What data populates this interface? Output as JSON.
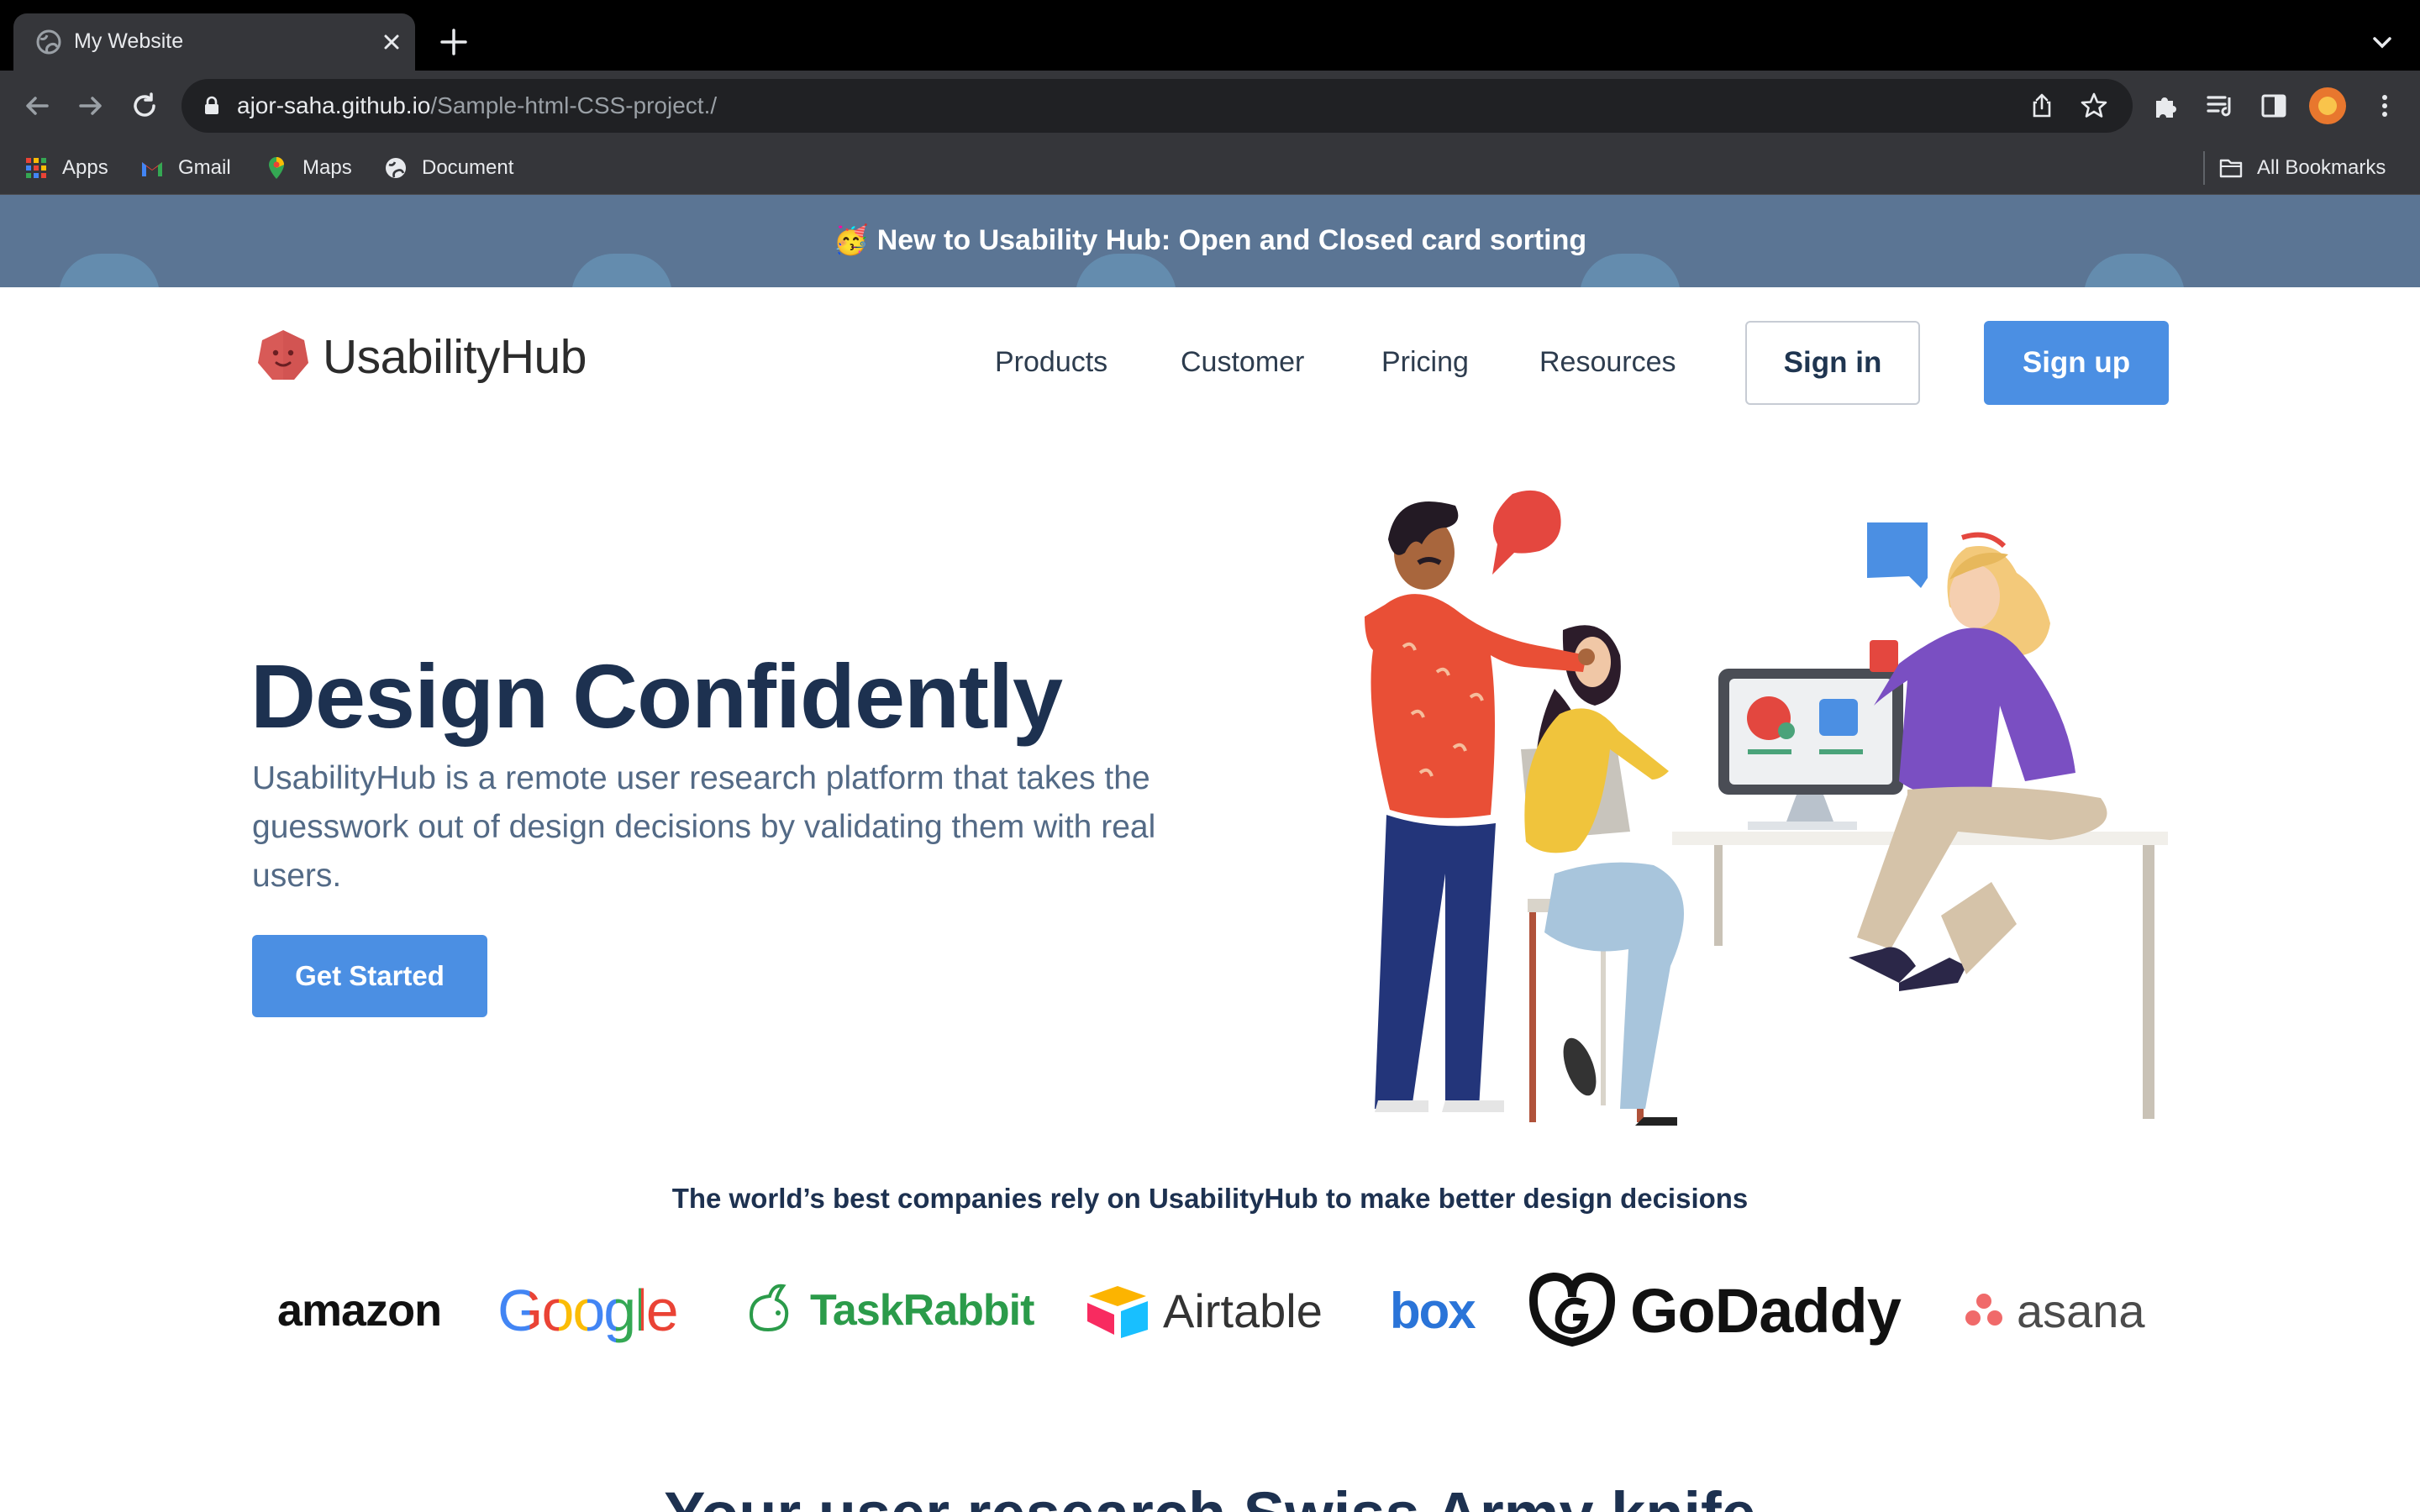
{
  "browser": {
    "tab_title": "My Website",
    "url_host": "ajor-saha.github.io",
    "url_path": "/Sample-html-CSS-project./",
    "bookmarks": [
      "Apps",
      "Gmail",
      "Maps",
      "Document"
    ],
    "all_bookmarks": "All Bookmarks"
  },
  "announcement": {
    "emoji": "🥳",
    "text": "New to Usability Hub: Open and Closed card sorting"
  },
  "header": {
    "logo": "UsabilityHub",
    "nav": [
      "Products",
      "Customer",
      "Pricing",
      "Resources"
    ],
    "signin": "Sign in",
    "signup": "Sign up"
  },
  "hero": {
    "title": "Design Confidently",
    "text": "UsabilityHub is a remote user research platform that takes the guesswork out of design decisions by validating them with real users.",
    "cta": "Get Started"
  },
  "companies": {
    "caption": "The world’s best companies rely on UsabilityHub to make better design decisions",
    "logos": [
      "amazon",
      "Google",
      "TaskRabbit",
      "Airtable",
      "box",
      "GoDaddy",
      "asana"
    ]
  },
  "next_section": {
    "heading": "Your user research Swiss Army knife"
  },
  "colors": {
    "brand_blue": "#4b8fe3",
    "heading_navy": "#1d3150",
    "body_slate": "#536a86",
    "banner": "#5b7594"
  }
}
